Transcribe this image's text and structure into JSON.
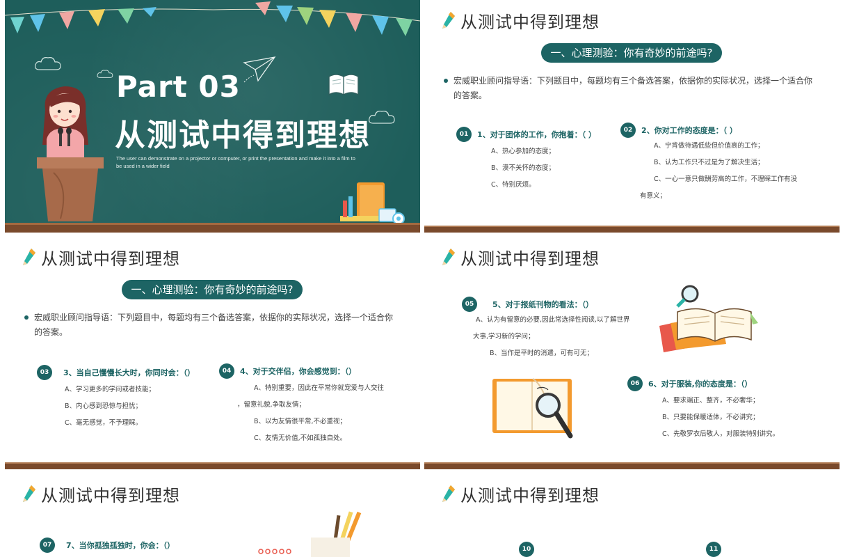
{
  "slide1": {
    "part": "Part 03",
    "title": "从测试中得到理想",
    "description": "The user can demonstrate on a projector or computer, or print the presentation and make it into a film to be used in a wider field"
  },
  "header_title": "从测试中得到理想",
  "slide2": {
    "section": "一、心理测验：你有奇妙的前途吗?",
    "intro": "宏威职业顾问指导语：下列题目中，每题均有三个备选答案，依据你的实际状况，选择一个适合你的答案。",
    "questions": [
      {
        "num": "01",
        "text": "1、对于团体的工作，你抱着：（ ）",
        "options": [
          "A、热心参加的态度；",
          "B、漠不关怀的态度；",
          "C、特别厌烦。"
        ]
      },
      {
        "num": "02",
        "text": "2、你对工作的态度是：（ ）",
        "options": [
          "A、宁肯做待遇低些但价值高的工作；",
          "B、认为工作只不过是为了解决生活；",
          "C、一心一意只做酬劳高的工作，不理睬工作有没",
          "有意义；"
        ]
      }
    ]
  },
  "slide3": {
    "section": "一、心理测验：你有奇妙的前途吗?",
    "intro": "宏威职业顾问指导语：下列题目中，每题均有三个备选答案，依据你的实际状况，选择一个适合你的答案。",
    "questions": [
      {
        "num": "03",
        "text": "3、当自己慢慢长大时，你同时会：（）",
        "options": [
          "A、学习更多的学问或者技能；",
          "B、内心感到恐惊与担忧；",
          "C、毫无感觉，不予理睬。"
        ]
      },
      {
        "num": "04",
        "text": "4、对于交伴侣，你会感觉到：（）",
        "options": [
          "A、特别重要，因此在平常你就宠爱与人交往",
          "，留意礼貌,争取友情；",
          "B、以为友情很平常,不必重视；",
          "C、友情无价值,不如孤独自处。"
        ]
      }
    ]
  },
  "slide4": {
    "questions": [
      {
        "num": "05",
        "text": "5、对于报纸刊物的看法：（）",
        "options": [
          "A、认为有留意的必要,因此常选择性阅读,以了解世界",
          "大事,学习新的学问；",
          "B、当作是平时的消遣，可有可无；"
        ]
      },
      {
        "num": "06",
        "text": "6、对于服装,你的态度是：（）",
        "options": [
          "A、要求端正、整齐，不必奢华；",
          "B、只要能保暖适体，不必讲究；",
          "C、先敬罗衣后敬人，对服装特别讲究。"
        ]
      }
    ]
  },
  "slide5": {
    "questions": [
      {
        "num": "07",
        "text": "7、当你孤独孤独时，你会：（）"
      }
    ]
  },
  "slide6": {
    "nums": [
      "10",
      "11"
    ]
  },
  "colors": {
    "accent": "#1d6464",
    "chalkboard": "#1e5e5b",
    "wood": "#7a4a2c"
  }
}
